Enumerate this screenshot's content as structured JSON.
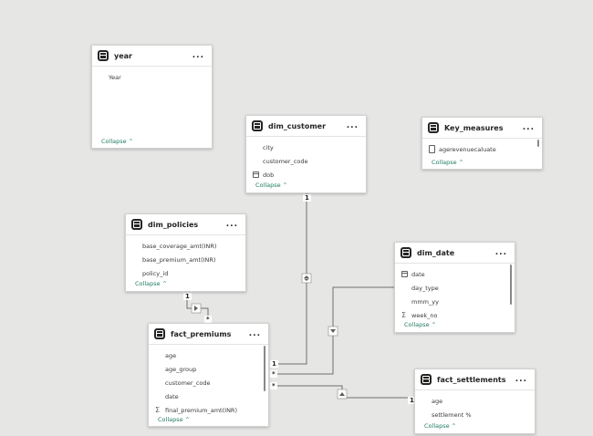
{
  "tables": {
    "year": {
      "title": "year",
      "fields": [
        "Year"
      ],
      "collapse_label": "Collapse"
    },
    "dim_customer": {
      "title": "dim_customer",
      "fields": [
        "city",
        "customer_code",
        "dob"
      ],
      "collapse_label": "Collapse"
    },
    "key_measures": {
      "title": "Key_measures",
      "fields": [
        "agerevenuecaluate"
      ],
      "collapse_label": "Collapse"
    },
    "dim_policies": {
      "title": "dim_policies",
      "fields": [
        "base_coverage_amt(INR)",
        "base_premium_amt(INR)",
        "policy_id"
      ],
      "collapse_label": "Collapse"
    },
    "dim_date": {
      "title": "dim_date",
      "fields": [
        "date",
        "day_type",
        "mmm_yy",
        "week_no"
      ],
      "collapse_label": "Collapse"
    },
    "fact_premiums": {
      "title": "fact_premiums",
      "fields": [
        "age",
        "age_group",
        "customer_code",
        "date",
        "final_premium_amt(INR)"
      ],
      "collapse_label": "Collapse"
    },
    "fact_settlements": {
      "title": "fact_settlements",
      "fields": [
        "age",
        "settlement %"
      ],
      "collapse_label": "Collapse"
    }
  },
  "more_label": "...",
  "relationships": {
    "one": "1",
    "many": "*"
  }
}
